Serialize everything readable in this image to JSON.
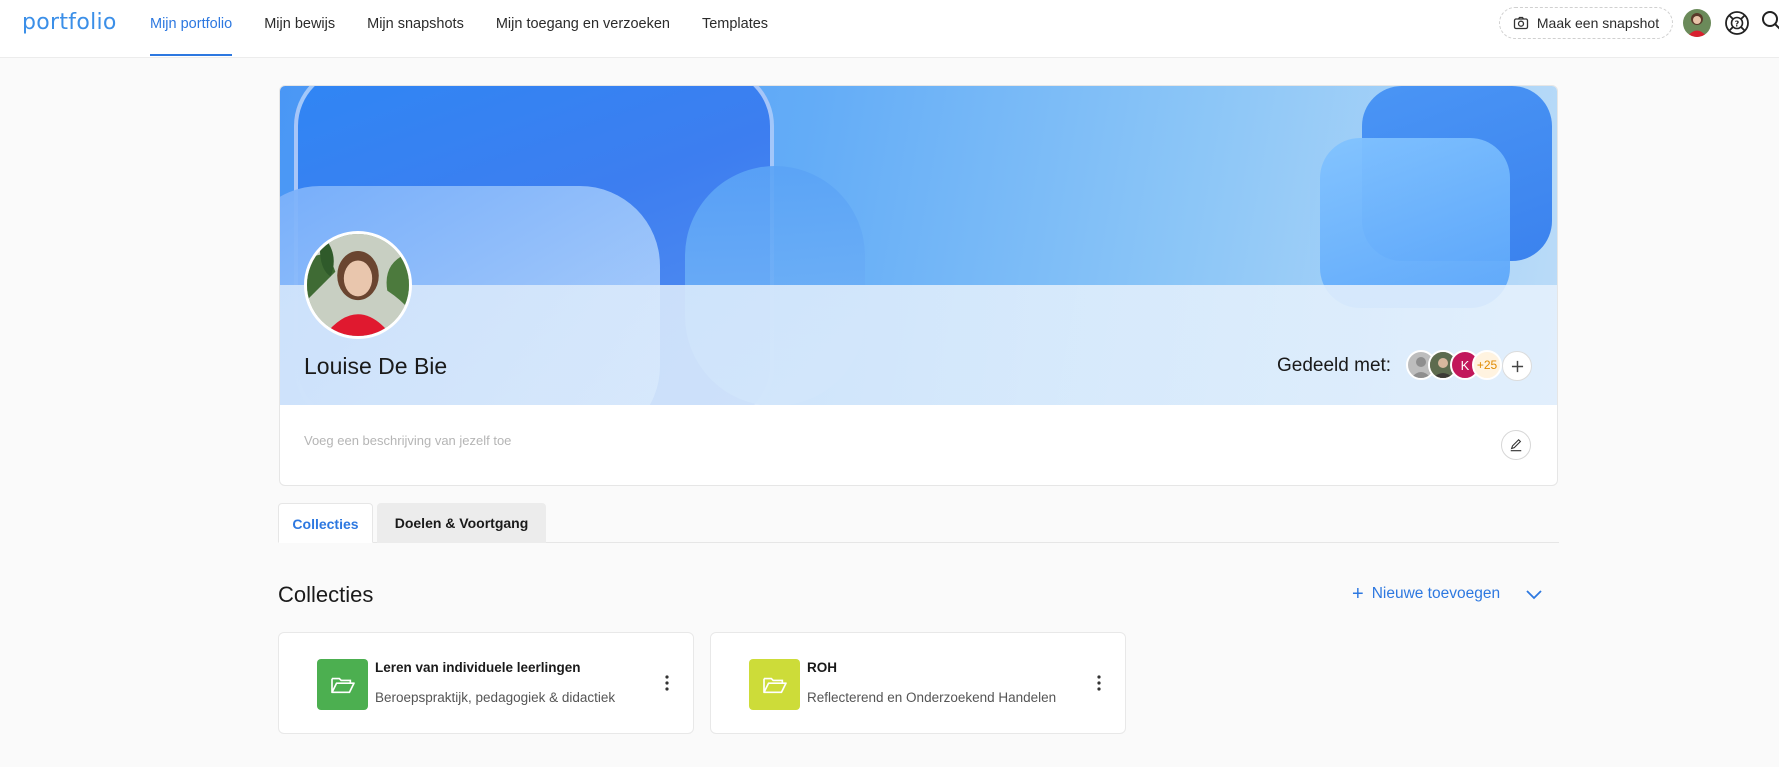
{
  "app": {
    "logo": "portfolio"
  },
  "nav": [
    {
      "label": "Mijn portfolio",
      "active": true
    },
    {
      "label": "Mijn bewijs"
    },
    {
      "label": "Mijn snapshots"
    },
    {
      "label": "Mijn toegang en verzoeken"
    },
    {
      "label": "Templates"
    }
  ],
  "toolbar": {
    "snapshot_label": "Maak een snapshot"
  },
  "profile": {
    "name": "Louise De Bie",
    "shared_label": "Gedeeld met:",
    "shared_count": "+25",
    "shared_initial": "K",
    "description_placeholder": "Voeg een beschrijving van jezelf toe"
  },
  "tabs": [
    {
      "label": "Collecties",
      "active": true
    },
    {
      "label": "Doelen & Voortgang"
    }
  ],
  "section": {
    "title": "Collecties",
    "new_label": "Nieuwe toevoegen"
  },
  "collections": [
    {
      "title": "Leren van individuele leerlingen",
      "subtitle": "Beroepspraktijk, pedagogiek & didactiek",
      "color": "#4caf50"
    },
    {
      "title": "ROH",
      "subtitle": "Reflecterend en Onderzoekend Handelen",
      "color": "#cddc39"
    }
  ],
  "colors": {
    "accent": "#2d78e0",
    "logo": "#3b8fe8"
  }
}
